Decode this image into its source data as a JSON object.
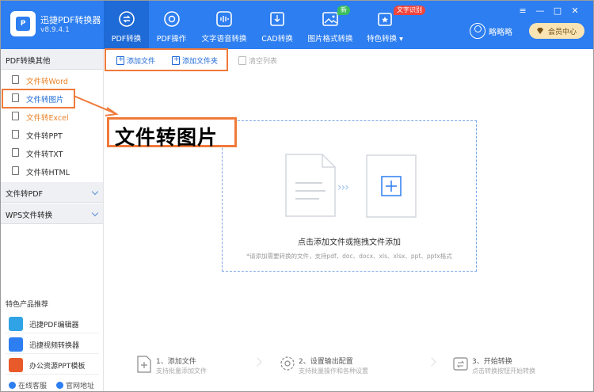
{
  "app": {
    "title": "迅捷PDF转换器",
    "version": "v8.9.4.1"
  },
  "tabs": [
    {
      "label": "PDF转换",
      "icon": "pdf-convert-icon",
      "active": true
    },
    {
      "label": "PDF操作",
      "icon": "pdf-operate-icon"
    },
    {
      "label": "文字语音转换",
      "icon": "audio-wave-icon"
    },
    {
      "label": "CAD转换",
      "icon": "cad-icon"
    },
    {
      "label": "图片格式转换",
      "icon": "image-icon",
      "badge": "新"
    },
    {
      "label": "特色转换",
      "icon": "feature-icon",
      "badge": "文字识别"
    }
  ],
  "user": {
    "name": "略略略",
    "vip_label": "会员中心"
  },
  "sidebar": {
    "group1": "PDF转换其他",
    "items": [
      {
        "label": "文件转Word",
        "icon": "file-icon"
      },
      {
        "label": "文件转图片",
        "icon": "image-file-icon"
      },
      {
        "label": "文件转Excel",
        "icon": "file-icon"
      },
      {
        "label": "文件转PPT",
        "icon": "file-icon"
      },
      {
        "label": "文件转TXT",
        "icon": "file-icon"
      },
      {
        "label": "文件转HTML",
        "icon": "file-icon"
      }
    ],
    "group2": "文件转PDF",
    "group3": "WPS文件转换",
    "recommend_title": "特色产品推荐",
    "recommend": [
      {
        "label": "迅捷PDF编辑器",
        "icon": "pdf-editor-icon",
        "color": "#2fa3e6"
      },
      {
        "label": "迅捷视频转换器",
        "icon": "video-converter-icon",
        "color": "#2d7ef0"
      },
      {
        "label": "办公资源PPT模板",
        "icon": "ppt-template-icon",
        "color": "#e85a2a"
      }
    ],
    "footer": {
      "support": "在线客服",
      "website": "官网地址"
    }
  },
  "toolbar": {
    "add_file": "添加文件",
    "add_folder": "添加文件夹",
    "clear": "清空列表"
  },
  "dropzone": {
    "main": "点击添加文件或拖拽文件添加",
    "hint": "*请添加需要转换的文件，支持pdf、doc、docx、xls、xlsx、ppt、pptx格式"
  },
  "steps": [
    {
      "title": "1、添加文件",
      "desc": "支持批量添加文件"
    },
    {
      "title": "2、设置输出配置",
      "desc": "支持批量操作和各种设置"
    },
    {
      "title": "3、开始转换",
      "desc": "点击转换按钮开始转换"
    }
  ],
  "callout": "文件转图片",
  "colors": {
    "brand": "#2d7ef0",
    "highlight": "#f07a3a",
    "orange_text": "#e8832a"
  }
}
